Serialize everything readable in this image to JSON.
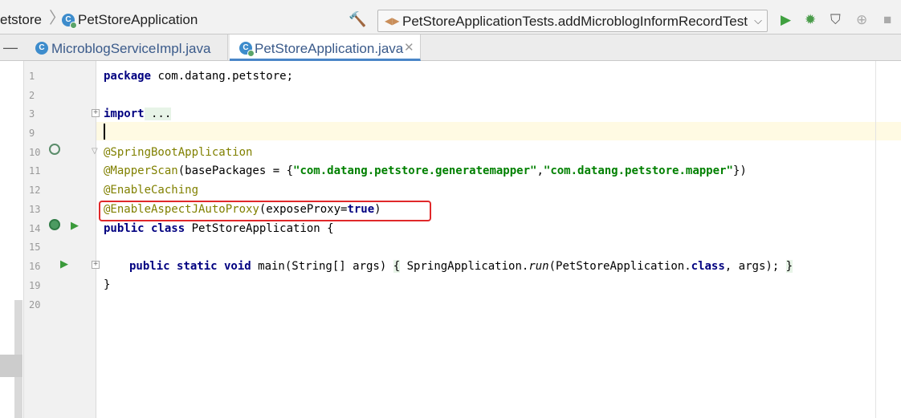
{
  "nav": {
    "breadcrumb_project": "etstore",
    "breadcrumb_sep": "〉",
    "breadcrumb_file": "PetStoreApplication",
    "run_config": "PetStoreApplicationTests.addMicroblogInformRecordTest"
  },
  "tabs": [
    {
      "label": "MicroblogServiceImpl.java",
      "active": false
    },
    {
      "label": "PetStoreApplication.java",
      "active": true
    }
  ],
  "gutter": {
    "line_numbers": [
      "1",
      "2",
      "3",
      "9",
      "10",
      "11",
      "12",
      "13",
      "14",
      "15",
      "16",
      "19",
      "20"
    ]
  },
  "code": {
    "l1_kw": "package",
    "l1_rest": " com.datang.petstore;",
    "l3_kw": "import",
    "l3_rest": " ...",
    "l10": "@SpringBootApplication",
    "l11_ann": "@MapperScan",
    "l11_a": "(basePackages = {",
    "l11_s1": "\"com.datang.petstore.generatemapper\"",
    "l11_c": ",",
    "l11_s2": "\"com.datang.petstore.mapper\"",
    "l11_e": "})",
    "l12": "@EnableCaching",
    "l13_ann": "@EnableAspectJAutoProxy",
    "l13_a": "(exposeProxy=",
    "l13_kw": "true",
    "l13_e": ")",
    "l14_kw": "public class",
    "l14_rest": " PetStoreApplication {",
    "l16_kw": "public static void",
    "l16_a": " main(String[] args) ",
    "l16_b": "{",
    "l16_c": " SpringApplication.",
    "l16_run": "run",
    "l16_d": "(PetStoreApplication.",
    "l16_kw2": "class",
    "l16_e": ", args); ",
    "l16_f": "}",
    "l19": "}"
  },
  "colors": {
    "keyword": "#000080",
    "annotation": "#808000",
    "string": "#008000",
    "highlight_box": "#e0282a"
  }
}
